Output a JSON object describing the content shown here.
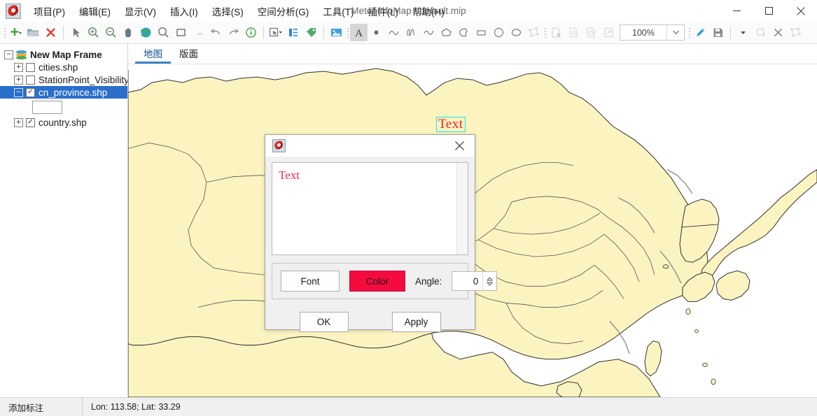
{
  "window": {
    "title": "MeteoInfoMap - default.mip",
    "minimize": "─",
    "maximize": "□",
    "close": "✕"
  },
  "menu": {
    "items": [
      {
        "label": "项目(P)",
        "name": "menu-project"
      },
      {
        "label": "编辑(E)",
        "name": "menu-edit"
      },
      {
        "label": "显示(V)",
        "name": "menu-view"
      },
      {
        "label": "插入(I)",
        "name": "menu-insert"
      },
      {
        "label": "选择(S)",
        "name": "menu-select"
      },
      {
        "label": "空间分析(G)",
        "name": "menu-spatial-analysis"
      },
      {
        "label": "工具(T)",
        "name": "menu-tools"
      },
      {
        "label": "插件(L)",
        "name": "menu-plugins"
      },
      {
        "label": "帮助(H)",
        "name": "menu-help"
      }
    ]
  },
  "toolbar": {
    "zoom_value": "100%",
    "icons": [
      "new-layer-icon",
      "open-folder-icon",
      "delete-icon",
      "select-arrow-icon",
      "zoom-in-icon",
      "zoom-out-icon",
      "pan-hand-icon",
      "full-extent-globe-icon",
      "identify-zoom-icon",
      "zoom-to-box-icon",
      "undo-icon",
      "redo-icon",
      "info-icon",
      "select-feature-icon",
      "attribute-table-icon",
      "label-tag-icon",
      "image-icon",
      "text-tool-icon",
      "point-icon",
      "polyline-icon",
      "freehand-icon",
      "curve-icon",
      "polygon-icon",
      "freehand-polygon-icon",
      "rectangle-icon",
      "circle-icon",
      "ellipse-icon",
      "curve-polygon-icon",
      "page-setup-icon",
      "zoom-page-in-icon",
      "zoom-page-out-icon",
      "fit-page-icon",
      "edit-pencil-icon",
      "save-edits-icon",
      "dropdown-arrow-icon",
      "edit-vertex-icon",
      "delete-feature-icon",
      "reshape-icon"
    ]
  },
  "toc": {
    "frame": "New Map Frame",
    "layers": [
      {
        "label": "cities.shp",
        "checked": false,
        "name": "layer-cities"
      },
      {
        "label": "StationPoint_Visibility_",
        "checked": false,
        "name": "layer-stationpoint-visibility"
      },
      {
        "label": "cn_province.shp",
        "checked": true,
        "selected": true,
        "name": "layer-cn-province"
      },
      {
        "label": "country.shp",
        "checked": true,
        "name": "layer-country"
      }
    ],
    "check_glyph": "✓"
  },
  "tabs": [
    {
      "label": "地图",
      "active": true,
      "name": "tab-map"
    },
    {
      "label": "版面",
      "active": false,
      "name": "tab-layout"
    }
  ],
  "map": {
    "annotation_text": "Text",
    "land_color": "#FBF4C0",
    "sea_color": "#FFFFFF",
    "border_color": "#303030",
    "text_color": "#FF1A1A",
    "selection_color": "#19E6E6"
  },
  "dialog": {
    "title": "",
    "close_glyph": "✕",
    "text_value": "Text",
    "font_button": "Font",
    "color_button": "Color",
    "color_swatch": "#F50C3F",
    "angle_label": "Angle:",
    "angle_value": "0",
    "ok_button": "OK",
    "apply_button": "Apply",
    "spin_up": "▴",
    "spin_down": "▾"
  },
  "status": {
    "mode": "添加标注",
    "coords": "Lon: 113.58; Lat: 33.29"
  }
}
